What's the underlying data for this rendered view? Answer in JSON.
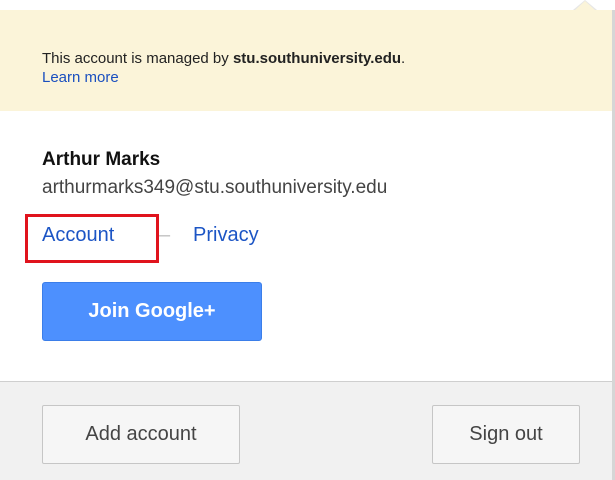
{
  "banner": {
    "prefix": "This account is managed by",
    "domain": "stu.southuniversity.edu",
    "suffix": ".",
    "learn_more": "Learn more"
  },
  "user": {
    "name": "Arthur Marks",
    "email": "arthurmarks349@stu.southuniversity.edu"
  },
  "links": {
    "account": "Account",
    "separator": "–",
    "privacy": "Privacy"
  },
  "join_button": "Join Google+",
  "footer": {
    "add_account": "Add account",
    "sign_out": "Sign out"
  },
  "colors": {
    "banner_bg": "#fbf4d9",
    "link": "#1c55c5",
    "highlight": "#e0131d",
    "join_button": "#4d90fe",
    "footer_bg": "#f1f1f1"
  }
}
